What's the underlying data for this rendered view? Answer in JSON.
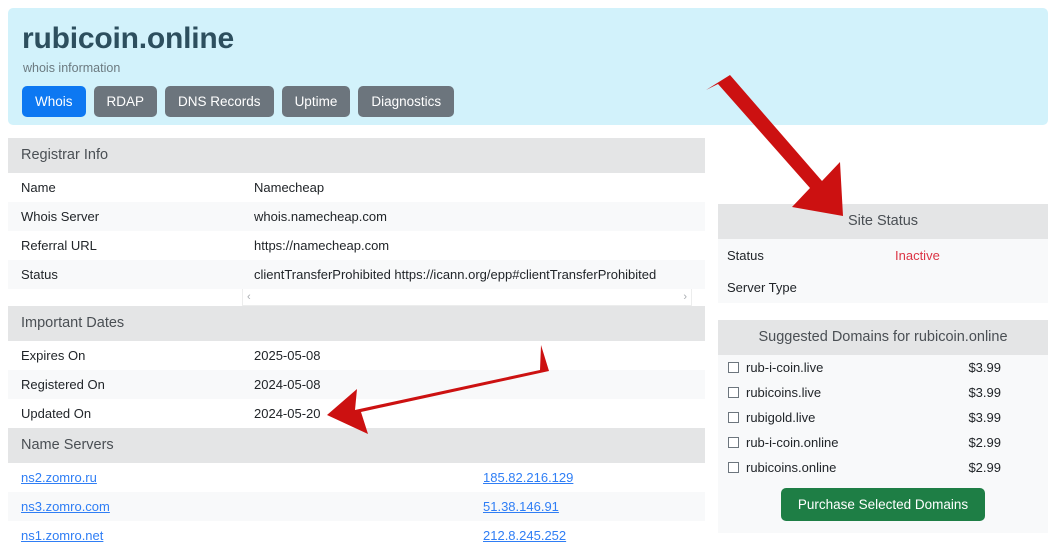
{
  "header": {
    "domain": "rubicoin.online",
    "subtitle": "whois information",
    "tabs": [
      {
        "label": "Whois",
        "active": true
      },
      {
        "label": "RDAP",
        "active": false
      },
      {
        "label": "DNS Records",
        "active": false
      },
      {
        "label": "Uptime",
        "active": false
      },
      {
        "label": "Diagnostics",
        "active": false
      }
    ]
  },
  "registrar": {
    "heading": "Registrar Info",
    "rows": [
      {
        "key": "Name",
        "value": "Namecheap"
      },
      {
        "key": "Whois Server",
        "value": "whois.namecheap.com"
      },
      {
        "key": "Referral URL",
        "value": "https://namecheap.com"
      },
      {
        "key": "Status",
        "value": "clientTransferProhibited https://icann.org/epp#clientTransferProhibited"
      }
    ],
    "scroll_left_icon": "‹",
    "scroll_right_icon": "›"
  },
  "dates": {
    "heading": "Important Dates",
    "rows": [
      {
        "key": "Expires On",
        "value": "2025-05-08"
      },
      {
        "key": "Registered On",
        "value": "2024-05-08"
      },
      {
        "key": "Updated On",
        "value": "2024-05-20"
      }
    ]
  },
  "nameservers": {
    "heading": "Name Servers",
    "rows": [
      {
        "host": "ns2.zomro.ru",
        "ip": "185.82.216.129"
      },
      {
        "host": "ns3.zomro.com",
        "ip": "51.38.146.91"
      },
      {
        "host": "ns1.zomro.net",
        "ip": "212.8.245.252"
      }
    ]
  },
  "site_status": {
    "heading": "Site Status",
    "rows": [
      {
        "key": "Status",
        "value": "Inactive"
      },
      {
        "key": "Server Type",
        "value": ""
      }
    ]
  },
  "suggested": {
    "heading": "Suggested Domains for rubicoin.online",
    "items": [
      {
        "name": "rub-i-coin.live",
        "price": "$3.99",
        "checked": false
      },
      {
        "name": "rubicoins.live",
        "price": "$3.99",
        "checked": false
      },
      {
        "name": "rubigold.live",
        "price": "$3.99",
        "checked": false
      },
      {
        "name": "rub-i-coin.online",
        "price": "$2.99",
        "checked": false
      },
      {
        "name": "rubicoins.online",
        "price": "$2.99",
        "checked": false
      }
    ],
    "purchase_label": "Purchase Selected Domains"
  },
  "colors": {
    "header_band": "#d2f2fb",
    "tab_active": "#0d78f2",
    "tab_inactive": "#6c757d",
    "section_head": "#e4e5e6",
    "link": "#2f7ef5",
    "status_inactive": "#dc3545",
    "purchase_button": "#1e7e45",
    "annotation_arrow": "#cc1111"
  },
  "annotations": [
    {
      "name": "arrow-to-site-status",
      "direction": "down-right"
    },
    {
      "name": "arrow-to-updated-on",
      "direction": "left-down"
    }
  ]
}
